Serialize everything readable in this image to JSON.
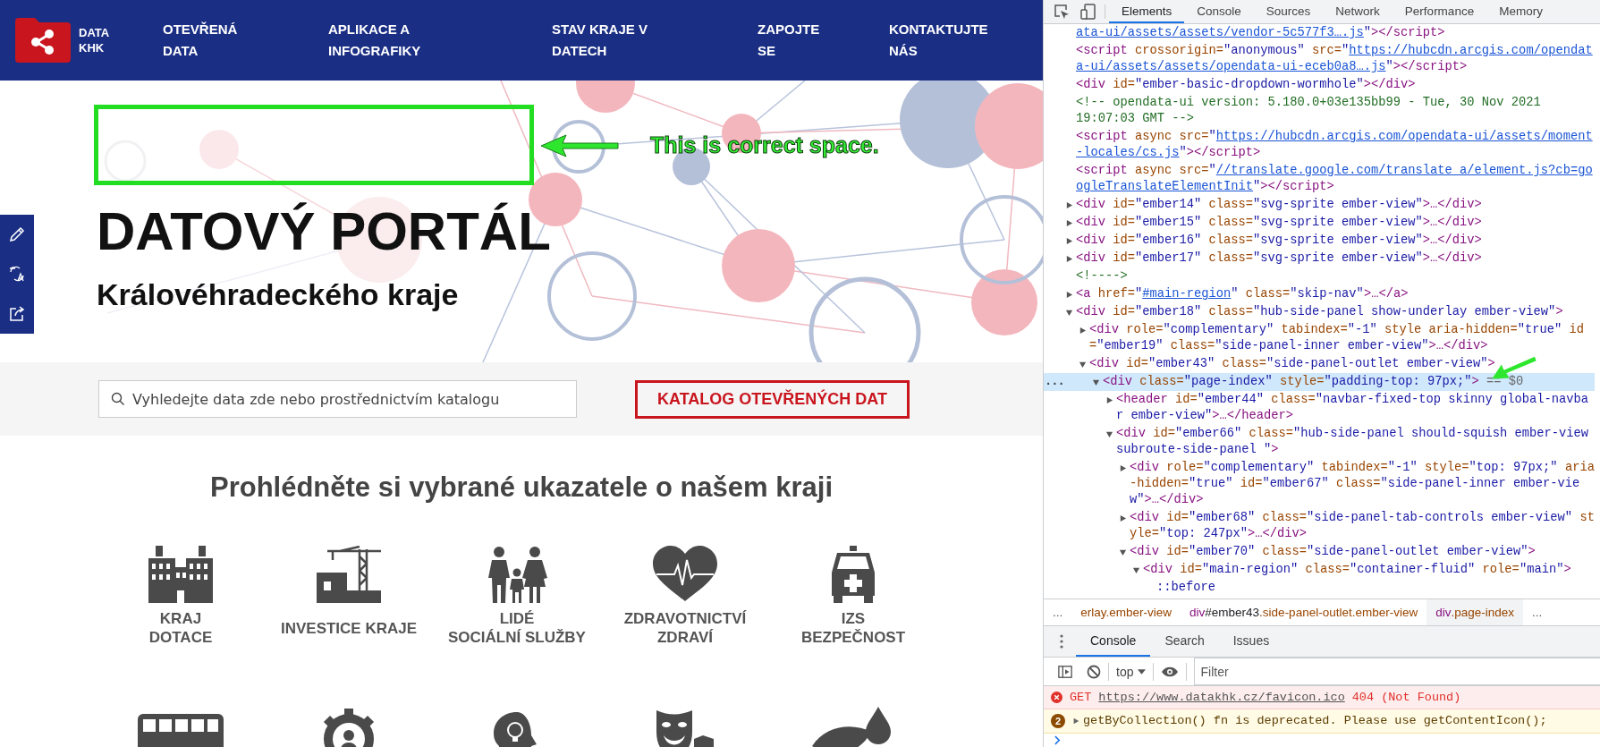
{
  "page": {
    "brand": {
      "name": "DATA\nKHK"
    },
    "nav": [
      {
        "label": "OTEVŘENÁ\nDATA"
      },
      {
        "label": "APLIKACE A\nINFOGRAFIKY"
      },
      {
        "label": "STAV KRAJE V\nDATECH"
      },
      {
        "label": "ZAPOJTE\nSE"
      },
      {
        "label": "KONTAKTUJTE\nNÁS"
      }
    ],
    "annotation": {
      "text": "This is correct space."
    },
    "hero": {
      "title": "DATOVÝ PORTÁL",
      "subtitle": "Královéhradeckého kraje"
    },
    "search": {
      "placeholder": "Vyhledejte data zde nebo prostřednictvím katalogu"
    },
    "catalog_button": "KATALOG OTEVŘENÝCH DAT",
    "section_title": "Prohlédněte si vybrané ukazatele o našem kraji",
    "categories": [
      {
        "kind": "building",
        "label": "KRAJ\nDOTACE"
      },
      {
        "kind": "crane",
        "label": "INVESTICE KRAJE"
      },
      {
        "kind": "family",
        "label": "LIDÉ\nSOCIÁLNÍ SLUŽBY"
      },
      {
        "kind": "heart",
        "label": "ZDRAVOTNICTVÍ\nZDRAVÍ"
      },
      {
        "kind": "ambulance",
        "label": "IZS\nBEZPEČNOST"
      },
      {
        "kind": "bus"
      },
      {
        "kind": "gear"
      },
      {
        "kind": "head"
      },
      {
        "kind": "mask"
      },
      {
        "kind": "leaf"
      }
    ]
  },
  "devtools": {
    "tabs": [
      {
        "label": "Elements",
        "selected": true
      },
      {
        "label": "Console",
        "selected": false
      },
      {
        "label": "Sources",
        "selected": false
      },
      {
        "label": "Network",
        "selected": false
      },
      {
        "label": "Performance",
        "selected": false
      },
      {
        "label": "Memory",
        "selected": false
      }
    ],
    "elements": {
      "nodes": [
        {
          "tokens": [
            {
              "kind": "link",
              "text": "ata-ui/assets/assets/vendor-5c577f3….js"
            },
            {
              "kind": "value",
              "text": "\""
            },
            {
              "kind": "tag",
              "text": "></script>"
            }
          ]
        },
        {
          "tokens": [
            {
              "kind": "tag",
              "text": "<script"
            },
            {
              "kind": "attr",
              "text": " crossorigin="
            },
            {
              "kind": "value",
              "text": "\"anonymous\""
            },
            {
              "kind": "attr",
              "text": " src="
            },
            {
              "kind": "value",
              "text": "\""
            },
            {
              "kind": "link",
              "text": "https://hubcdn.arcgis.com/opendata-ui/assets/assets/opendata-ui-eceb0a8….js"
            },
            {
              "kind": "value",
              "text": "\""
            },
            {
              "kind": "tag",
              "text": "></script>"
            }
          ]
        },
        {
          "tokens": [
            {
              "kind": "tag",
              "text": "<div"
            },
            {
              "kind": "attr",
              "text": " id="
            },
            {
              "kind": "value",
              "text": "\"ember-basic-dropdown-wormhole\""
            },
            {
              "kind": "tag",
              "text": "></div>"
            }
          ]
        },
        {
          "tokens": [
            {
              "kind": "comment",
              "text": "<!-- opendata-ui version: 5.180.0+03e135bb99 - Tue, 30 Nov 2021 19:07:03 GMT -->"
            }
          ]
        },
        {
          "tokens": [
            {
              "kind": "tag",
              "text": "<script"
            },
            {
              "kind": "attr",
              "text": " async"
            },
            {
              "kind": "attr",
              "text": " src="
            },
            {
              "kind": "value",
              "text": "\""
            },
            {
              "kind": "link",
              "text": "https://hubcdn.arcgis.com/opendata-ui/assets/moment-locales/cs.js"
            },
            {
              "kind": "value",
              "text": "\""
            },
            {
              "kind": "tag",
              "text": "></script>"
            }
          ]
        },
        {
          "tokens": [
            {
              "kind": "tag",
              "text": "<script"
            },
            {
              "kind": "attr",
              "text": " async"
            },
            {
              "kind": "attr",
              "text": " src="
            },
            {
              "kind": "value",
              "text": "\""
            },
            {
              "kind": "link",
              "text": "//translate.google.com/translate_a/element.js?cb=googleTranslateElementInit"
            },
            {
              "kind": "value",
              "text": "\""
            },
            {
              "kind": "tag",
              "text": "></script>"
            }
          ]
        },
        {
          "expanded": false,
          "tokens": [
            {
              "kind": "tag",
              "text": "<div"
            },
            {
              "kind": "attr",
              "text": " id="
            },
            {
              "kind": "value",
              "text": "\"ember14\""
            },
            {
              "kind": "attr",
              "text": " class="
            },
            {
              "kind": "value",
              "text": "\"svg-sprite ember-view\""
            },
            {
              "kind": "tag",
              "text": ">…</div>"
            }
          ]
        },
        {
          "expanded": false,
          "tokens": [
            {
              "kind": "tag",
              "text": "<div"
            },
            {
              "kind": "attr",
              "text": " id="
            },
            {
              "kind": "value",
              "text": "\"ember15\""
            },
            {
              "kind": "attr",
              "text": " class="
            },
            {
              "kind": "value",
              "text": "\"svg-sprite ember-view\""
            },
            {
              "kind": "tag",
              "text": ">…</div>"
            }
          ]
        },
        {
          "expanded": false,
          "tokens": [
            {
              "kind": "tag",
              "text": "<div"
            },
            {
              "kind": "attr",
              "text": " id="
            },
            {
              "kind": "value",
              "text": "\"ember16\""
            },
            {
              "kind": "attr",
              "text": " class="
            },
            {
              "kind": "value",
              "text": "\"svg-sprite ember-view\""
            },
            {
              "kind": "tag",
              "text": ">…</div>"
            }
          ]
        },
        {
          "expanded": false,
          "tokens": [
            {
              "kind": "tag",
              "text": "<div"
            },
            {
              "kind": "attr",
              "text": " id="
            },
            {
              "kind": "value",
              "text": "\"ember17\""
            },
            {
              "kind": "attr",
              "text": " class="
            },
            {
              "kind": "value",
              "text": "\"svg-sprite ember-view\""
            },
            {
              "kind": "tag",
              "text": ">…</div>"
            }
          ]
        },
        {
          "tokens": [
            {
              "kind": "comment",
              "text": "<!---->"
            }
          ]
        },
        {
          "expanded": false,
          "tokens": [
            {
              "kind": "tag",
              "text": "<a"
            },
            {
              "kind": "attr",
              "text": " href="
            },
            {
              "kind": "value",
              "text": "\""
            },
            {
              "kind": "link",
              "text": "#main-region"
            },
            {
              "kind": "value",
              "text": "\""
            },
            {
              "kind": "attr",
              "text": " class="
            },
            {
              "kind": "value",
              "text": "\"skip-nav\""
            },
            {
              "kind": "tag",
              "text": ">…</a>"
            }
          ]
        },
        {
          "expanded": true,
          "tokens": [
            {
              "kind": "tag",
              "text": "<div"
            },
            {
              "kind": "attr",
              "text": " id="
            },
            {
              "kind": "value",
              "text": "\"ember18\""
            },
            {
              "kind": "attr",
              "text": " class="
            },
            {
              "kind": "value",
              "text": "\"hub-side-panel show-underlay ember-view\""
            },
            {
              "kind": "tag",
              "text": ">"
            }
          ],
          "children": [
            {
              "expanded": false,
              "tokens": [
                {
                  "kind": "tag",
                  "text": "<div"
                },
                {
                  "kind": "attr",
                  "text": " role="
                },
                {
                  "kind": "value",
                  "text": "\"complementary\""
                },
                {
                  "kind": "attr",
                  "text": " tabindex="
                },
                {
                  "kind": "value",
                  "text": "\"-1\""
                },
                {
                  "kind": "attr",
                  "text": " style"
                },
                {
                  "kind": "attr",
                  "text": " aria-hidden="
                },
                {
                  "kind": "value",
                  "text": "\"true\""
                },
                {
                  "kind": "attr",
                  "text": " id="
                },
                {
                  "kind": "value",
                  "text": "\"ember19\""
                },
                {
                  "kind": "attr",
                  "text": " class="
                },
                {
                  "kind": "value",
                  "text": "\"side-panel-inner ember-view\""
                },
                {
                  "kind": "tag",
                  "text": ">…</div>"
                }
              ]
            },
            {
              "expanded": true,
              "tokens": [
                {
                  "kind": "tag",
                  "text": "<div"
                },
                {
                  "kind": "attr",
                  "text": " id="
                },
                {
                  "kind": "value",
                  "text": "\"ember43\""
                },
                {
                  "kind": "attr",
                  "text": " class="
                },
                {
                  "kind": "value",
                  "text": "\"side-panel-outlet ember-view\""
                },
                {
                  "kind": "tag",
                  "text": ">"
                }
              ],
              "children": [
                {
                  "expanded": true,
                  "selected": true,
                  "gutter": "...",
                  "marker": "== $0",
                  "tokens": [
                    {
                      "kind": "tag",
                      "text": "<div"
                    },
                    {
                      "kind": "attr",
                      "text": " class="
                    },
                    {
                      "kind": "value",
                      "text": "\"page-index\""
                    },
                    {
                      "kind": "attr",
                      "text": " style="
                    },
                    {
                      "kind": "value",
                      "text": "\"padding-top: 97px;\""
                    },
                    {
                      "kind": "tag",
                      "text": ">"
                    }
                  ],
                  "children": [
                    {
                      "expanded": false,
                      "tokens": [
                        {
                          "kind": "tag",
                          "text": "<header"
                        },
                        {
                          "kind": "attr",
                          "text": " id="
                        },
                        {
                          "kind": "value",
                          "text": "\"ember44\""
                        },
                        {
                          "kind": "attr",
                          "text": " class="
                        },
                        {
                          "kind": "value",
                          "text": "\"navbar-fixed-top skinny global-navbar ember-view\""
                        },
                        {
                          "kind": "tag",
                          "text": ">…</header>"
                        }
                      ]
                    },
                    {
                      "expanded": true,
                      "tokens": [
                        {
                          "kind": "tag",
                          "text": "<div"
                        },
                        {
                          "kind": "attr",
                          "text": " id="
                        },
                        {
                          "kind": "value",
                          "text": "\"ember66\""
                        },
                        {
                          "kind": "attr",
                          "text": " class="
                        },
                        {
                          "kind": "value",
                          "text": "\"hub-side-panel should-squish ember-view subroute-side-panel \""
                        },
                        {
                          "kind": "tag",
                          "text": ">"
                        }
                      ],
                      "children": [
                        {
                          "expanded": false,
                          "tokens": [
                            {
                              "kind": "tag",
                              "text": "<div"
                            },
                            {
                              "kind": "attr",
                              "text": " role="
                            },
                            {
                              "kind": "value",
                              "text": "\"complementary\""
                            },
                            {
                              "kind": "attr",
                              "text": " tabindex="
                            },
                            {
                              "kind": "value",
                              "text": "\"-1\""
                            },
                            {
                              "kind": "attr",
                              "text": " style="
                            },
                            {
                              "kind": "value",
                              "text": "\"top: 97px;\""
                            },
                            {
                              "kind": "attr",
                              "text": " aria-hidden="
                            },
                            {
                              "kind": "value",
                              "text": "\"true\""
                            },
                            {
                              "kind": "attr",
                              "text": " id="
                            },
                            {
                              "kind": "value",
                              "text": "\"ember67\""
                            },
                            {
                              "kind": "attr",
                              "text": " class="
                            },
                            {
                              "kind": "value",
                              "text": "\"side-panel-inner ember-view\""
                            },
                            {
                              "kind": "tag",
                              "text": ">…</div>"
                            }
                          ]
                        },
                        {
                          "expanded": false,
                          "tokens": [
                            {
                              "kind": "tag",
                              "text": "<div"
                            },
                            {
                              "kind": "attr",
                              "text": " id="
                            },
                            {
                              "kind": "value",
                              "text": "\"ember68\""
                            },
                            {
                              "kind": "attr",
                              "text": " class="
                            },
                            {
                              "kind": "value",
                              "text": "\"side-panel-tab-controls ember-view\""
                            },
                            {
                              "kind": "attr",
                              "text": " style="
                            },
                            {
                              "kind": "value",
                              "text": "\"top: 247px\""
                            },
                            {
                              "kind": "tag",
                              "text": ">…</div>"
                            }
                          ]
                        },
                        {
                          "expanded": true,
                          "tokens": [
                            {
                              "kind": "tag",
                              "text": "<div"
                            },
                            {
                              "kind": "attr",
                              "text": " id="
                            },
                            {
                              "kind": "value",
                              "text": "\"ember70\""
                            },
                            {
                              "kind": "attr",
                              "text": " class="
                            },
                            {
                              "kind": "value",
                              "text": "\"side-panel-outlet ember-view\""
                            },
                            {
                              "kind": "tag",
                              "text": ">"
                            }
                          ],
                          "children": [
                            {
                              "expanded": true,
                              "tokens": [
                                {
                                  "kind": "tag",
                                  "text": "<div"
                                },
                                {
                                  "kind": "attr",
                                  "text": " id="
                                },
                                {
                                  "kind": "value",
                                  "text": "\"main-region\""
                                },
                                {
                                  "kind": "attr",
                                  "text": " class="
                                },
                                {
                                  "kind": "value",
                                  "text": "\"container-fluid\""
                                },
                                {
                                  "kind": "attr",
                                  "text": " role="
                                },
                                {
                                  "kind": "value",
                                  "text": "\"main\""
                                },
                                {
                                  "kind": "tag",
                                  "text": ">"
                                }
                              ],
                              "children": [
                                {
                                  "tokens": [
                                    {
                                      "kind": "pseudo",
                                      "text": "::before"
                                    }
                                  ]
                                }
                              ]
                            }
                          ]
                        }
                      ]
                    }
                  ]
                }
              ]
            }
          ]
        }
      ]
    },
    "breadcrumbs": {
      "overflow_left": "...",
      "overflow_right": "...",
      "items": [
        {
          "selector": "erlay.ember-view",
          "selected": false
        },
        {
          "tag": "div",
          "id": "#ember43",
          "selector": ".side-panel-outlet.ember-view",
          "selected": false
        },
        {
          "tag": "div",
          "selector": ".page-index",
          "selected": true
        }
      ]
    },
    "drawer": {
      "tabs": [
        {
          "label": "Console",
          "selected": true
        },
        {
          "label": "Search",
          "selected": false
        },
        {
          "label": "Issues",
          "selected": false
        }
      ],
      "context": "top",
      "filter_placeholder": "Filter",
      "messages": [
        {
          "kind": "error",
          "method": "GET",
          "url": "https://www.datakhk.cz/favicon.ico",
          "status": "404 (Not Found)"
        },
        {
          "kind": "warning",
          "count": "2",
          "text": "getByCollection() fn is deprecated. Please use getContentIcon();"
        }
      ]
    }
  }
}
